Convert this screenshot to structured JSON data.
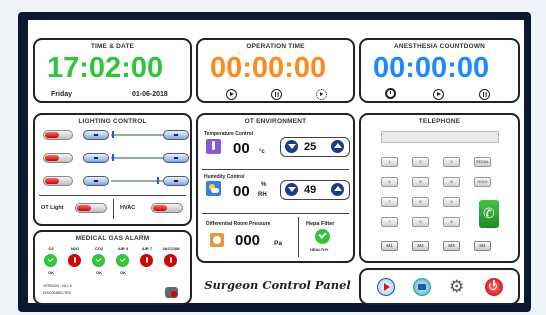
{
  "time_date": {
    "title": "TIME & DATE",
    "time": "17:02:00",
    "day": "Friday",
    "date": "01-06-2018"
  },
  "operation_time": {
    "title": "OPERATION TIME",
    "time": "00:00:00"
  },
  "anesthesia": {
    "title": "ANESTHESIA COUNTDOWN",
    "time": "00:00:00"
  },
  "lighting": {
    "title": "LIGHTING CONTROL",
    "ot_light": "OT Light",
    "hvac": "HVAC"
  },
  "ot_env": {
    "title": "OT ENVIRONMENT",
    "temp_label": "Temperature Control",
    "temp_value": "00",
    "temp_unit": "°c",
    "temp_set": "25",
    "hum_label": "Humidity Control",
    "hum_value": "00",
    "hum_unit_top": "%",
    "hum_unit_bottom": "RH",
    "hum_set": "49",
    "pressure_label": "Differential Room Pressure",
    "pressure_value": "000",
    "pressure_unit": "Pa",
    "hepa_label": "Hepa Filter",
    "hepa_status": "HEALTHY"
  },
  "telephone": {
    "title": "TELEPHONE",
    "keys": [
      "1",
      "2",
      "3",
      "REDIAL",
      "4",
      "5",
      "6",
      "HOLD",
      "7",
      "8",
      "9",
      "",
      "*",
      "0",
      "#",
      ""
    ],
    "memory": [
      "M1",
      "M2",
      "M3",
      "M4"
    ]
  },
  "gas": {
    "title": "MEDICAL GAS ALARM",
    "items": [
      {
        "name": "O2",
        "status": "OK",
        "ok": true
      },
      {
        "name": "N2O",
        "status": "",
        "ok": false
      },
      {
        "name": "CO2",
        "status": "OK",
        "ok": true
      },
      {
        "name": "AIR 4",
        "status": "OK",
        "ok": true
      },
      {
        "name": "AIR 7",
        "status": "",
        "ok": false
      },
      {
        "name": "VACCUM",
        "status": "",
        "ok": false
      }
    ],
    "version": "VERSION : V8 1.0",
    "connection": "DISCONNECTED"
  },
  "footer": {
    "title": "Surgeon Control Panel"
  },
  "colors": {
    "green": "#31c43b",
    "orange": "#ff8a1c",
    "blue": "#1e88ff",
    "red": "#d60000"
  }
}
